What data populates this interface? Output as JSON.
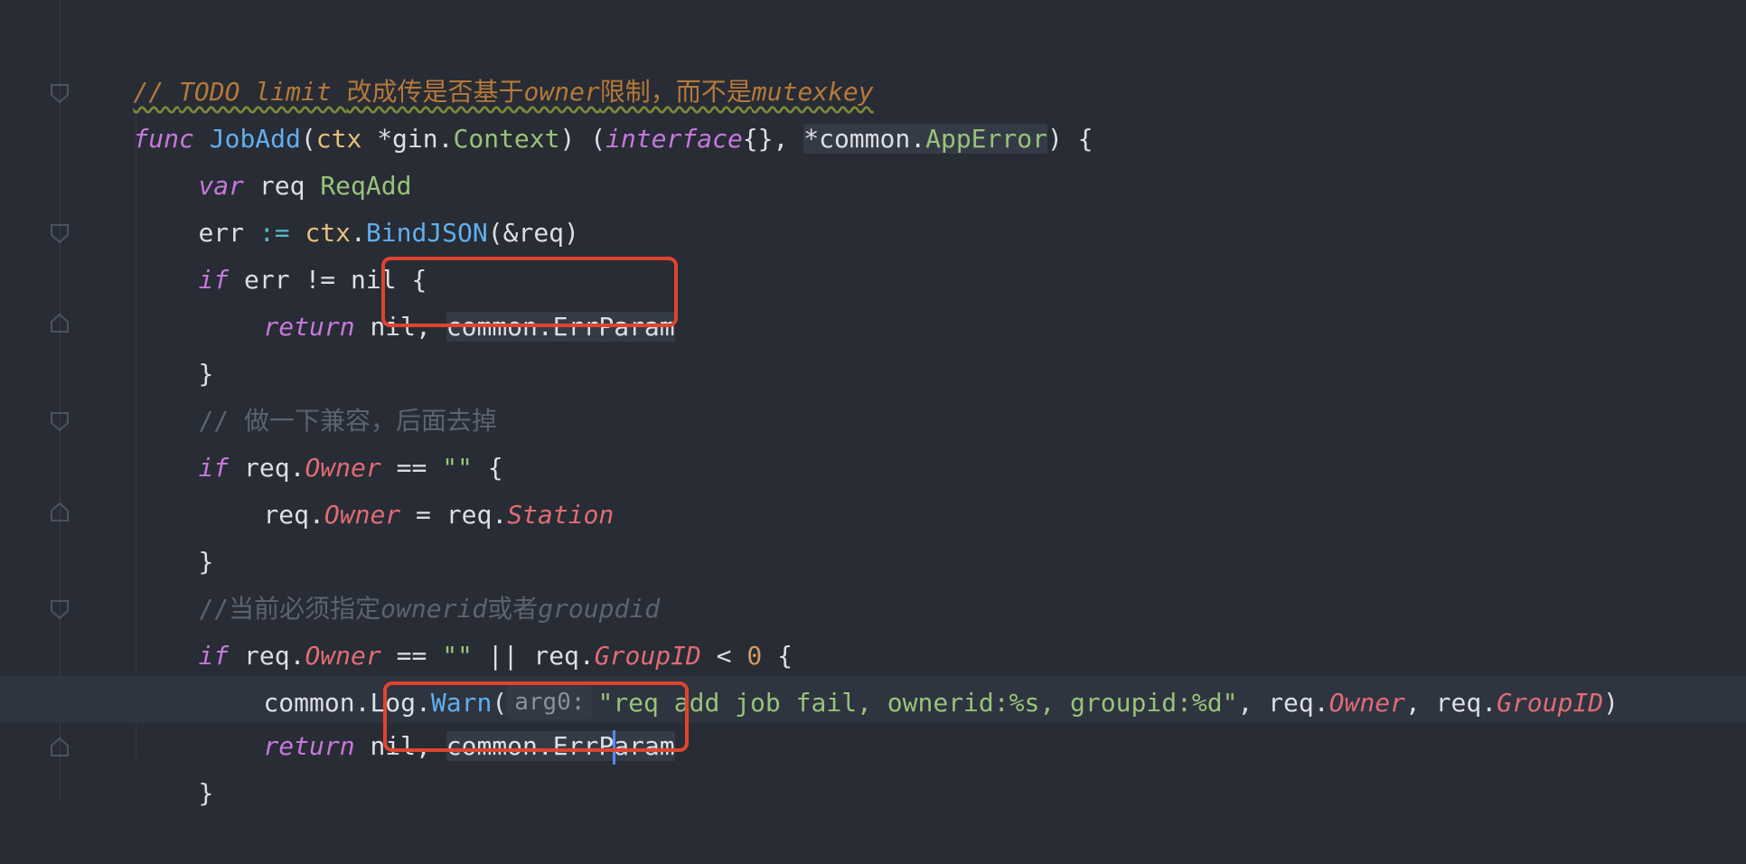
{
  "editor": {
    "lines": {
      "l1": {
        "slashes": "// ",
        "todo": "TODO limit ",
        "cn1": "改成传是否基于",
        "owner": "owner",
        "cn2": "限制，而不是",
        "mutexkey": "mutexkey"
      },
      "l2": {
        "func": "func",
        "name": "JobAdd",
        "ctx": "ctx",
        "star": "*",
        "gin": "gin",
        "context": "Context",
        "iface": "interface",
        "common": "common",
        "apperror": "AppError"
      },
      "l3": {
        "var": "var",
        "req": "req",
        "type": "ReqAdd"
      },
      "l4": {
        "err": "err",
        "assign": ":=",
        "ctx": "ctx",
        "bind": "BindJSON",
        "arg": "(&req)"
      },
      "l5": {
        "if": "if",
        "cond": "err != nil {"
      },
      "l6": {
        "ret": "return",
        "nil": "nil,",
        "common": "common",
        "errparam": "ErrParam"
      },
      "l7": {
        "brace": "}"
      },
      "l8": {
        "comment": "// 做一下兼容，后面去掉"
      },
      "l9": {
        "if": "if",
        "req": "req.",
        "owner": "Owner",
        "eq": " == ",
        "str": "\"\"",
        "brace": " {"
      },
      "l10": {
        "req": "req.",
        "owner": "Owner",
        "assign": " = ",
        "req2": "req.",
        "station": "Station"
      },
      "l11": {
        "brace": "}"
      },
      "l12": {
        "c1": "//当前必须指定",
        "c2": "ownerid",
        "c3": "或者",
        "c4": "groupdid"
      },
      "l13": {
        "if": "if",
        "req": "req.",
        "owner": "Owner",
        "eq": " == ",
        "str": "\"\"",
        "or": " || ",
        "req2": "req.",
        "groupid": "GroupID",
        "lt": " < ",
        "zero": "0",
        "brace": " {"
      },
      "l14": {
        "common": "common",
        "log": "Log",
        "warn": "Warn",
        "inlay": "arg0:",
        "str": "\"req add job fail, ownerid:%s, groupid:%d\"",
        "req1": "req.",
        "owner": "Owner",
        "req2": "req.",
        "groupid": "GroupID"
      },
      "l15": {
        "ret": "return",
        "nil": "nil,",
        "common": "common",
        "errp1": "ErrP",
        "errp2": "aram"
      },
      "l16": {
        "brace": "}"
      }
    },
    "colors": {
      "background": "#282c34",
      "keyword": "#c678dd",
      "function": "#61afef",
      "type": "#98c379",
      "field": "#e06c75",
      "comment": "#5c6370",
      "todo": "#b5793a",
      "highlight_box": "#e0442e"
    }
  }
}
